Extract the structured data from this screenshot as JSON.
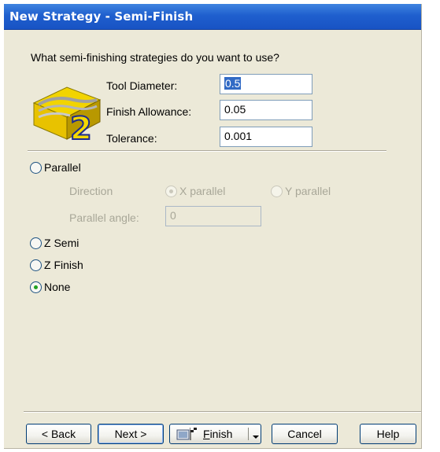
{
  "window": {
    "title": "New Strategy - Semi-Finish"
  },
  "main": {
    "question": "What semi-finishing strategies do you want to use?",
    "badge_number": "2",
    "fields": [
      {
        "label": "Tool Diameter:",
        "value": "0.5",
        "selected": true
      },
      {
        "label": "Finish Allowance:",
        "value": "0.05",
        "selected": false
      },
      {
        "label": "Tolerance:",
        "value": "0.001",
        "selected": false
      }
    ],
    "strategies": {
      "parallel": {
        "label": "Parallel",
        "checked": false
      },
      "direction_label": "Direction",
      "x_parallel": {
        "label": "X parallel",
        "checked": true,
        "disabled": true
      },
      "y_parallel": {
        "label": "Y parallel",
        "checked": false,
        "disabled": true
      },
      "parallel_angle_label": "Parallel angle:",
      "parallel_angle_value": "0",
      "z_semi": {
        "label": "Z Semi",
        "checked": false
      },
      "z_finish": {
        "label": "Z Finish",
        "checked": false
      },
      "none": {
        "label": "None",
        "checked": true
      }
    }
  },
  "buttons": {
    "back": "< Back",
    "next": "Next >",
    "finish_letter": "F",
    "finish_rest": "inish",
    "cancel": "Cancel",
    "help": "Help"
  },
  "icons": {
    "wizard": "3d-part-icon",
    "finish": "finish-flag-icon",
    "dropdown": "dropdown-arrow-icon"
  },
  "colors": {
    "titlebar": "#1f5fce",
    "dialog": "#ece9d8",
    "radio_check": "#21a121",
    "selection": "#316ac5"
  }
}
